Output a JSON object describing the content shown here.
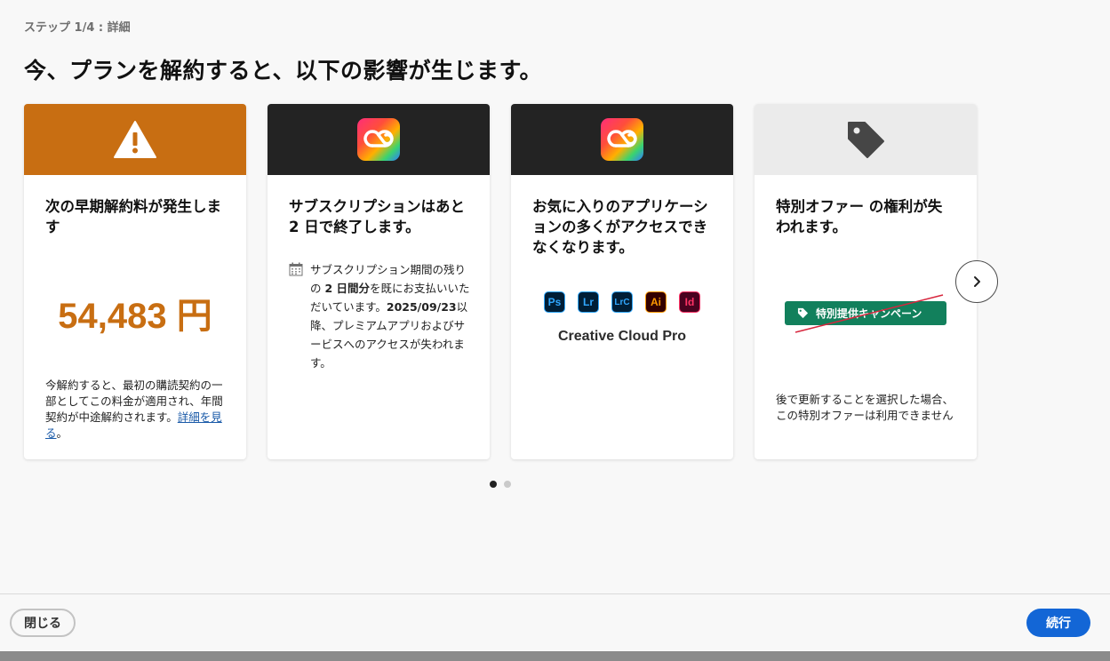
{
  "step_label": "ステップ 1/4 : 詳細",
  "title": "今、プランを解約すると、以下の影響が生じます。",
  "cards": {
    "fee": {
      "icon": "warning-icon",
      "header_color": "#c86e12",
      "heading": "次の早期解約料が発生します",
      "amount": "54,483 円",
      "note": "今解約すると、最初の購読契約の一部としてこの料金が適用され、年間契約が中途解約されます。",
      "link": "詳細を見る",
      "note_end": "。"
    },
    "subscription": {
      "icon": "creative-cloud-icon",
      "header_color": "#232323",
      "heading": "サブスクリプションはあと 2 日で終了します。",
      "detail_a": "サブスクリプション期間の残りの ",
      "detail_b": "2 日間分",
      "detail_c": "を既にお支払いいただいています。",
      "detail_d": "2025/09/23",
      "detail_e": "以降、プレミアムアプリおよびサービスへのアクセスが失われます。"
    },
    "apps": {
      "icon": "creative-cloud-icon",
      "header_color": "#232323",
      "heading": "お気に入りのアプリケーションの多くがアクセスできなくなります。",
      "app_icons": [
        {
          "label": "Ps",
          "bg": "#001e36",
          "fg": "#31a8ff"
        },
        {
          "label": "Lr",
          "bg": "#001e36",
          "fg": "#31a8ff"
        },
        {
          "label": "LrC",
          "bg": "#001e36",
          "fg": "#31a8ff"
        },
        {
          "label": "Ai",
          "bg": "#330000",
          "fg": "#ff9a00"
        },
        {
          "label": "Id",
          "bg": "#49021f",
          "fg": "#ff3366"
        }
      ],
      "product": "Creative Cloud Pro"
    },
    "offer": {
      "icon": "tag-icon",
      "header_color": "#ebebeb",
      "heading": "特別オファー の権利が失われます。",
      "pill": "特別提供キャンペーン",
      "note": "後で更新することを選択した場合、この特別オファーは利用できません"
    }
  },
  "pagination": {
    "total": 2,
    "current": 1
  },
  "buttons": {
    "close": "閉じる",
    "continue": "続行"
  }
}
